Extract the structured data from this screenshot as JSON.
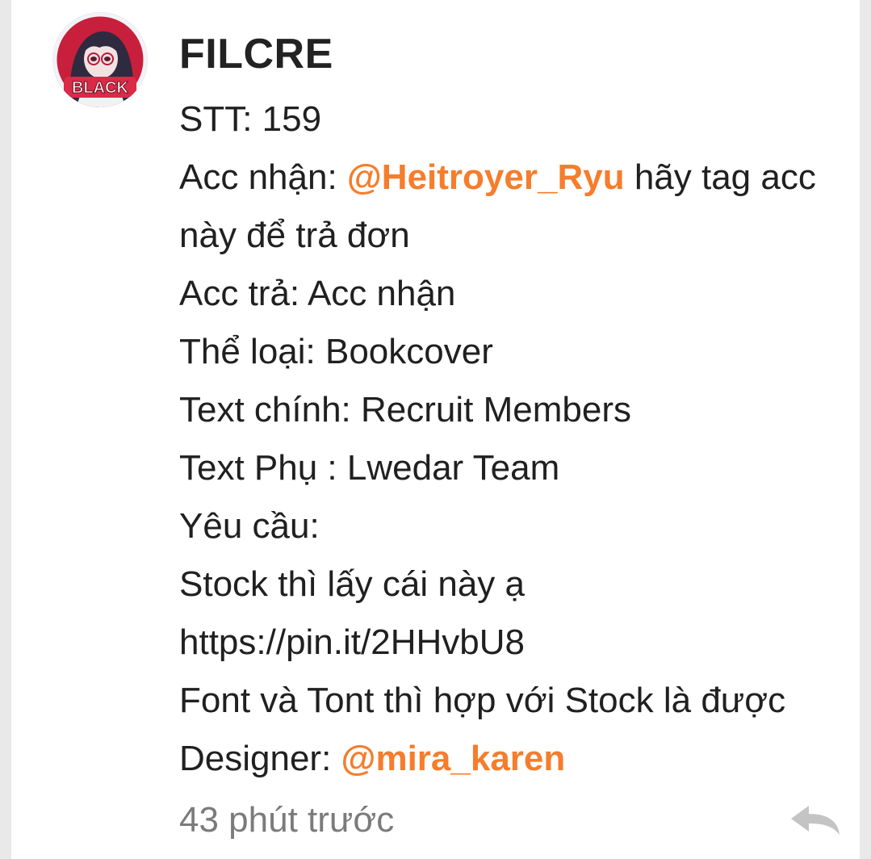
{
  "comment": {
    "author": "FILCRE",
    "avatar": {
      "icon": "avatar-badge",
      "badge_text": "BLACK"
    },
    "lines": [
      {
        "text": "STT: 159"
      },
      {
        "prefix": "Acc nhận: ",
        "mention": "@Heitroyer_Ryu",
        "suffix": " hãy tag acc"
      },
      {
        "text": "này để trả đơn"
      },
      {
        "text": "Acc trả: Acc nhận"
      },
      {
        "text": "Thể loại: Bookcover"
      },
      {
        "text": "Text chính: Recruit Members"
      },
      {
        "text": "Text Phụ : Lwedar Team"
      },
      {
        "text": "Yêu cầu:"
      },
      {
        "text": "Stock thì lấy cái này ạ"
      },
      {
        "text": "https://pin.it/2HHvbU8"
      },
      {
        "text": "Font và Tont thì hợp với Stock là được"
      },
      {
        "prefix": "Designer: ",
        "mention": "@mira_karen"
      }
    ],
    "timestamp": "43 phút trước",
    "reply_icon": "reply-arrow-icon"
  },
  "colors": {
    "mention": "#f57d2c",
    "text": "#202020",
    "muted": "#7b7b7b",
    "reply_icon": "#c4c4c4"
  }
}
